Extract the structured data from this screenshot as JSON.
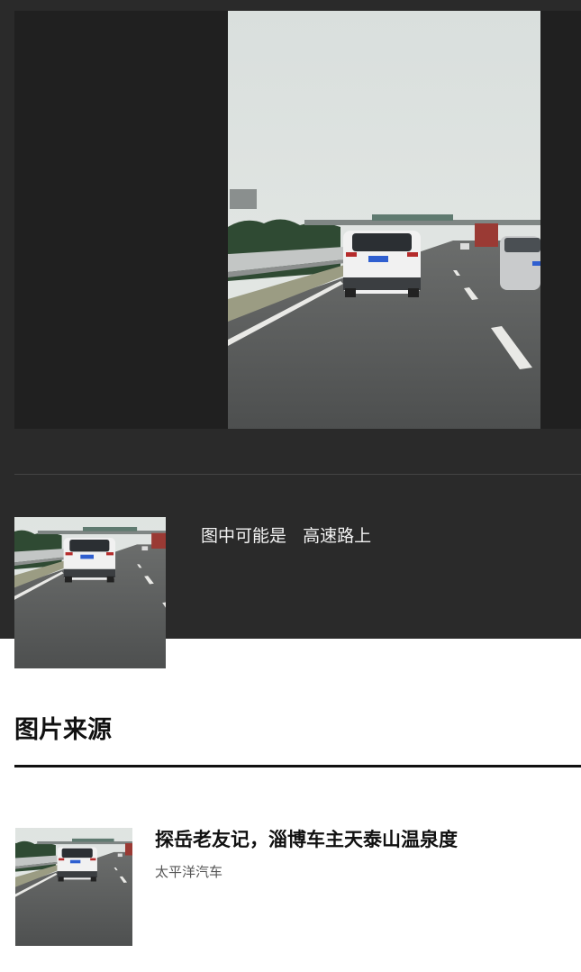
{
  "caption": {
    "prefix": "图中可能是",
    "label": "高速路上"
  },
  "section": {
    "title": "图片来源"
  },
  "results": [
    {
      "title": "探岳老友记，淄博车主天泰山温泉度",
      "source": "太平洋汽车"
    }
  ],
  "colors": {
    "dark_bg": "#2a2a2a",
    "viewer_bg": "#202020",
    "text_dark": "#111111"
  }
}
